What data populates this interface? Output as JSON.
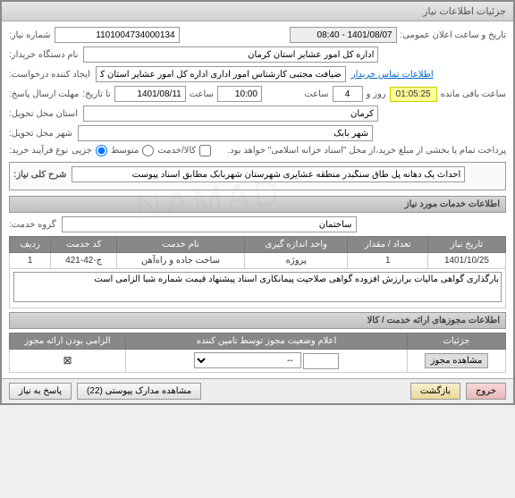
{
  "window": {
    "title": "جزئیات اطلاعات نیاز"
  },
  "header": {
    "lbl_need_no": "شماره نیاز:",
    "need_no": "1101004734000134",
    "lbl_org": "نام دستگاه خریدار:",
    "org": "اداره کل امور عشایر استان کرمان",
    "lbl_requester": "ایجاد کننده درخواست:",
    "requester": "ضیافت مجتبی کارشناس امور اداری اداره کل امور عشایر استان کرمان",
    "contact_link": "اطلاعات تماس خریدار",
    "lbl_deadline": "مهلت ارسال پاسخ:",
    "lbl_todate": "تا تاریخ:",
    "deadline_date": "1401/08/11",
    "lbl_hour": "ساعت",
    "deadline_hour": "10:00",
    "lbl_days": "روز و",
    "days": "4",
    "timer": "01:05:25",
    "lbl_remain": "ساعت باقی مانده",
    "lbl_pubdate": "تاریخ و ساعت اعلان عمومی:",
    "pubdate": "1401/08/07 - 08:40",
    "lbl_province": "استان محل تحویل:",
    "province": "کرمان",
    "lbl_city": "شهر محل تحویل:",
    "city": "شهر بابک",
    "lbl_ptype": "نوع فرآیند خرید:",
    "r1": "جزیی",
    "r2": "متوسط",
    "ptype_note": "پرداخت تمام یا بخشی از مبلغ خرید،از محل \"اسناد خزانه اسلامی\" خواهد بود.",
    "lbl_calserv": "کالا/خدمت"
  },
  "need": {
    "lbl": "شرح کلی نیاز:",
    "value": "احداث یک دهانه پل طاق سنگبدر منطقه عشایری شهرستان شهربابک مطابق اسناد پیوست"
  },
  "sections": {
    "services": "اطلاعات خدمات مورد نیاز",
    "permits": "اطلاعات مجوزهای ارائه خدمت / کالا"
  },
  "service_group": {
    "lbl": "گروه خدمت:",
    "value": "ساختمان"
  },
  "table": {
    "h1": "ردیف",
    "h2": "کد خدمت",
    "h3": "نام خدمت",
    "h4": "واحد اندازه گیری",
    "h5": "تعداد / مقدار",
    "h6": "تاریخ نیاز",
    "r1c1": "1",
    "r1c2": "ج-42-421",
    "r1c3": "ساخت جاده و راه‌آهن",
    "r1c4": "پروژه",
    "r1c5": "1",
    "r1c6": "1401/10/25"
  },
  "note": "بارگذاری گواهی مالیات برارزش افزوده گواهی صلاحیت پیمانکاری اسناد پیشنهاد قیمت شماره شبا الزامی است",
  "permits_table": {
    "h1": "الزامی بودن ارائه مجوز",
    "h2": "اعلام وضعیت مجوز توسط تامین کننده",
    "h3": "جزئیات",
    "sel_default": "--",
    "btn_view": "مشاهده مجوز"
  },
  "buttons": {
    "answer": "پاسخ به نیاز",
    "attachments": "مشاهده مدارک پیوستی (22)",
    "back": "بازگشت",
    "exit": "خروج"
  },
  "watermark": "NAMAD"
}
